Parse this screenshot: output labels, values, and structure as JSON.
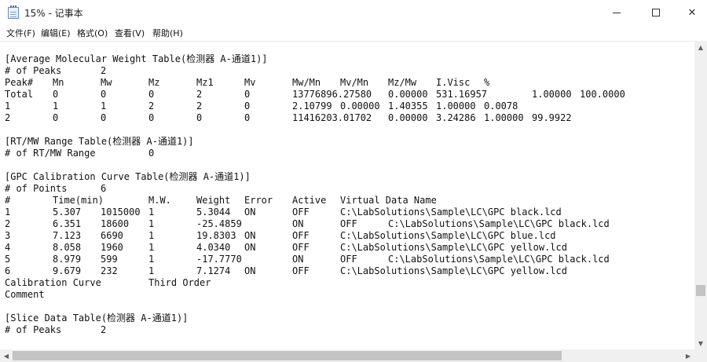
{
  "window": {
    "title": "15% - 记事本",
    "minimize_glyph": "",
    "maximize_glyph": "",
    "close_glyph": "✕",
    "app_icon": "notepad-icon"
  },
  "menu": [
    {
      "label": "文件(F)"
    },
    {
      "label": "编辑(E)"
    },
    {
      "label": "格式(O)"
    },
    {
      "label": "查看(V)"
    },
    {
      "label": "帮助(H)"
    }
  ],
  "document": {
    "lines": [
      {
        "cells": [
          {
            "t": "[Average Molecular Weight Table(检测器 A-通道1)]",
            "c": 0
          }
        ]
      },
      {
        "cells": [
          {
            "t": "# of Peaks",
            "c": 0
          },
          {
            "t": "2",
            "c": 20
          }
        ]
      },
      {
        "cells": [
          {
            "t": "Peak#",
            "c": 0
          },
          {
            "t": "Mn",
            "c": 10
          },
          {
            "t": "Mw",
            "c": 20
          },
          {
            "t": "Mz",
            "c": 30
          },
          {
            "t": "Mz1",
            "c": 40
          },
          {
            "t": "Mv",
            "c": 50
          },
          {
            "t": "Mw/Mn",
            "c": 60
          },
          {
            "t": "Mv/Mn",
            "c": 70
          },
          {
            "t": "Mz/Mw",
            "c": 80
          },
          {
            "t": "I.Visc",
            "c": 90
          },
          {
            "t": "%",
            "c": 100
          }
        ]
      },
      {
        "cells": [
          {
            "t": "Total",
            "c": 0
          },
          {
            "t": "0",
            "c": 10
          },
          {
            "t": "0",
            "c": 20
          },
          {
            "t": "0",
            "c": 30
          },
          {
            "t": "2",
            "c": 40
          },
          {
            "t": "0",
            "c": 50
          },
          {
            "t": "13776896.27580",
            "c": 60
          },
          {
            "t": "0.00000",
            "c": 80
          },
          {
            "t": "531.16957",
            "c": 90
          },
          {
            "t": "1.00000",
            "c": 110
          },
          {
            "t": "100.0000",
            "c": 120
          }
        ]
      },
      {
        "cells": [
          {
            "t": "1",
            "c": 0
          },
          {
            "t": "1",
            "c": 10
          },
          {
            "t": "1",
            "c": 20
          },
          {
            "t": "2",
            "c": 30
          },
          {
            "t": "2",
            "c": 40
          },
          {
            "t": "0",
            "c": 50
          },
          {
            "t": "2.10799",
            "c": 60
          },
          {
            "t": "0.00000",
            "c": 70
          },
          {
            "t": "1.40355",
            "c": 80
          },
          {
            "t": "1.00000",
            "c": 90
          },
          {
            "t": "0.0078",
            "c": 100
          }
        ]
      },
      {
        "cells": [
          {
            "t": "2",
            "c": 0
          },
          {
            "t": "0",
            "c": 10
          },
          {
            "t": "0",
            "c": 20
          },
          {
            "t": "0",
            "c": 30
          },
          {
            "t": "0",
            "c": 40
          },
          {
            "t": "0",
            "c": 50
          },
          {
            "t": "11416203.01702",
            "c": 60
          },
          {
            "t": "0.00000",
            "c": 80
          },
          {
            "t": "3.24286",
            "c": 90
          },
          {
            "t": "1.00000",
            "c": 100
          },
          {
            "t": "99.9922",
            "c": 110
          }
        ]
      },
      {
        "cells": []
      },
      {
        "cells": [
          {
            "t": "[RT/MW Range Table(检测器 A-通道1)]",
            "c": 0
          }
        ]
      },
      {
        "cells": [
          {
            "t": "# of RT/MW Range",
            "c": 0
          },
          {
            "t": "0",
            "c": 30
          }
        ]
      },
      {
        "cells": []
      },
      {
        "cells": [
          {
            "t": "[GPC Calibration Curve Table(检测器 A-通道1)]",
            "c": 0
          }
        ]
      },
      {
        "cells": [
          {
            "t": "# of Points",
            "c": 0
          },
          {
            "t": "6",
            "c": 20
          }
        ]
      },
      {
        "cells": [
          {
            "t": "#",
            "c": 0
          },
          {
            "t": "Time(min)",
            "c": 10
          },
          {
            "t": "M.W.",
            "c": 30
          },
          {
            "t": "Weight",
            "c": 40
          },
          {
            "t": "Error",
            "c": 50
          },
          {
            "t": "Active",
            "c": 60
          },
          {
            "t": "Virtual Data Name",
            "c": 70
          }
        ]
      },
      {
        "cells": [
          {
            "t": "1",
            "c": 0
          },
          {
            "t": "5.307",
            "c": 10
          },
          {
            "t": "1015000",
            "c": 20
          },
          {
            "t": "1",
            "c": 30
          },
          {
            "t": "5.3044",
            "c": 40
          },
          {
            "t": "ON",
            "c": 50
          },
          {
            "t": "OFF",
            "c": 60
          },
          {
            "t": "C:\\LabSolutions\\Sample\\LC\\GPC black.lcd",
            "c": 70
          }
        ]
      },
      {
        "cells": [
          {
            "t": "2",
            "c": 0
          },
          {
            "t": "6.351",
            "c": 10
          },
          {
            "t": "18600",
            "c": 20
          },
          {
            "t": "1",
            "c": 30
          },
          {
            "t": "-25.4859",
            "c": 40
          },
          {
            "t": "ON",
            "c": 60
          },
          {
            "t": "OFF",
            "c": 70
          },
          {
            "t": "C:\\LabSolutions\\Sample\\LC\\GPC black.lcd",
            "c": 80
          }
        ]
      },
      {
        "cells": [
          {
            "t": "3",
            "c": 0
          },
          {
            "t": "7.123",
            "c": 10
          },
          {
            "t": "6690",
            "c": 20
          },
          {
            "t": "1",
            "c": 30
          },
          {
            "t": "19.8303",
            "c": 40
          },
          {
            "t": "ON",
            "c": 50
          },
          {
            "t": "OFF",
            "c": 60
          },
          {
            "t": "C:\\LabSolutions\\Sample\\LC\\GPC blue.lcd",
            "c": 70
          }
        ]
      },
      {
        "cells": [
          {
            "t": "4",
            "c": 0
          },
          {
            "t": "8.058",
            "c": 10
          },
          {
            "t": "1960",
            "c": 20
          },
          {
            "t": "1",
            "c": 30
          },
          {
            "t": "4.0340",
            "c": 40
          },
          {
            "t": "ON",
            "c": 50
          },
          {
            "t": "OFF",
            "c": 60
          },
          {
            "t": "C:\\LabSolutions\\Sample\\LC\\GPC yellow.lcd",
            "c": 70
          }
        ]
      },
      {
        "cells": [
          {
            "t": "5",
            "c": 0
          },
          {
            "t": "8.979",
            "c": 10
          },
          {
            "t": "599",
            "c": 20
          },
          {
            "t": "1",
            "c": 30
          },
          {
            "t": "-17.7770",
            "c": 40
          },
          {
            "t": "ON",
            "c": 60
          },
          {
            "t": "OFF",
            "c": 70
          },
          {
            "t": "C:\\LabSolutions\\Sample\\LC\\GPC black.lcd",
            "c": 80
          }
        ]
      },
      {
        "cells": [
          {
            "t": "6",
            "c": 0
          },
          {
            "t": "9.679",
            "c": 10
          },
          {
            "t": "232",
            "c": 20
          },
          {
            "t": "1",
            "c": 30
          },
          {
            "t": "7.1274",
            "c": 40
          },
          {
            "t": "ON",
            "c": 50
          },
          {
            "t": "OFF",
            "c": 60
          },
          {
            "t": "C:\\LabSolutions\\Sample\\LC\\GPC yellow.lcd",
            "c": 70
          }
        ]
      },
      {
        "cells": [
          {
            "t": "Calibration Curve",
            "c": 0
          },
          {
            "t": "Third Order",
            "c": 30
          }
        ]
      },
      {
        "cells": [
          {
            "t": "Comment",
            "c": 0
          }
        ]
      },
      {
        "cells": []
      },
      {
        "cells": [
          {
            "t": "[Slice Data Table(检测器 A-通道1)]",
            "c": 0
          }
        ]
      },
      {
        "cells": [
          {
            "t": "# of Peaks",
            "c": 0
          },
          {
            "t": "2",
            "c": 20
          }
        ]
      }
    ]
  },
  "scrollbars": {
    "vertical": {
      "position": 0.85,
      "visible_fraction": 0.04,
      "up_glyph": "▲",
      "down_glyph": "▼"
    },
    "horizontal": {
      "position": 0.0,
      "visible_fraction": 0.82,
      "left_glyph": "◀",
      "right_glyph": "▶"
    }
  }
}
